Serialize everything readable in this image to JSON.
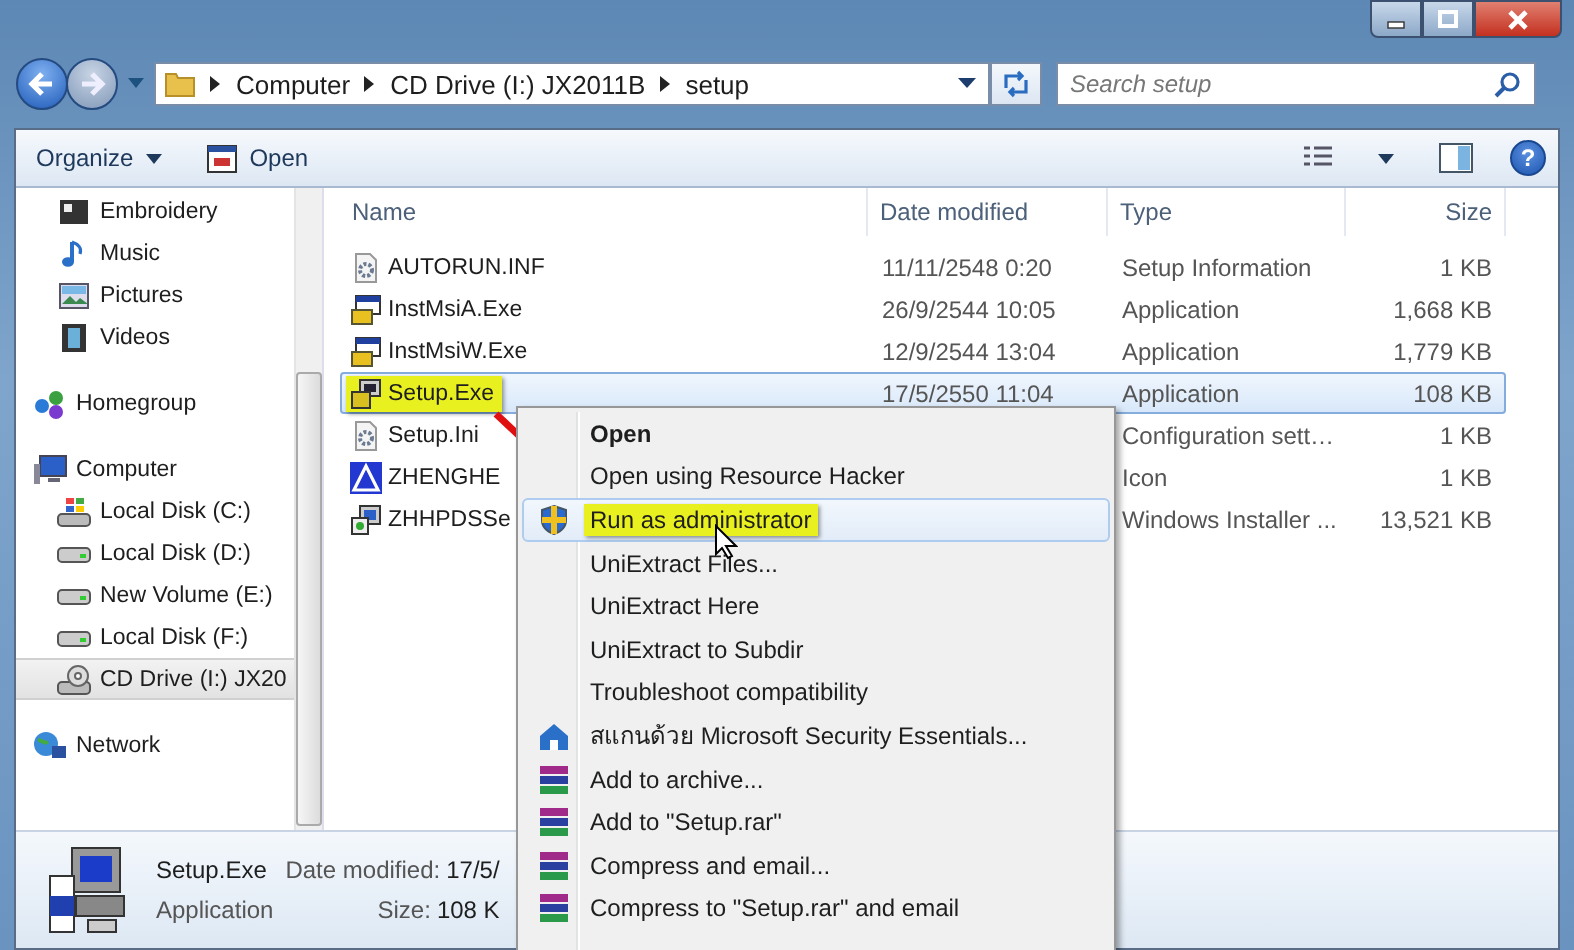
{
  "address_bar": {
    "crumbs": [
      "Computer",
      "CD Drive (I:) JX2011B",
      "setup"
    ]
  },
  "search": {
    "placeholder": "Search setup"
  },
  "toolbar": {
    "buttons": [
      {
        "label": "Organize",
        "kind": "menu"
      },
      {
        "label": "Open",
        "kind": "open"
      }
    ],
    "help": "?"
  },
  "sidebar": {
    "groups": [
      {
        "children": [
          {
            "label": "Embroidery",
            "selected": false
          },
          {
            "label": "Music",
            "selected": false
          },
          {
            "label": "Pictures",
            "selected": false
          },
          {
            "label": "Videos",
            "selected": false
          }
        ]
      },
      {
        "label": "Homegroup"
      },
      {
        "label": "Computer",
        "children": [
          {
            "label": "Local Disk (C:)",
            "selected": false
          },
          {
            "label": "Local Disk (D:)",
            "selected": false
          },
          {
            "label": "New Volume (E:)",
            "selected": false
          },
          {
            "label": "Local Disk (F:)",
            "selected": false
          },
          {
            "label": "CD Drive (I:) JX20",
            "selected": true
          }
        ]
      },
      {
        "label": "Network"
      }
    ]
  },
  "table": {
    "columns": [
      "Name",
      "Date modified",
      "Type",
      "Size"
    ],
    "rows": [
      {
        "name": "AUTORUN.INF",
        "date": "11/11/2548 0:20",
        "type": "Setup Information",
        "size": "1 KB",
        "selected": false,
        "highlighted": false
      },
      {
        "name": "InstMsiA.Exe",
        "date": "26/9/2544 10:05",
        "type": "Application",
        "size": "1,668 KB",
        "selected": false,
        "highlighted": false
      },
      {
        "name": "InstMsiW.Exe",
        "date": "12/9/2544 13:04",
        "type": "Application",
        "size": "1,779 KB",
        "selected": false,
        "highlighted": false
      },
      {
        "name": "Setup.Exe",
        "date": "17/5/2550 11:04",
        "type": "Application",
        "size": "108 KB",
        "selected": true,
        "highlighted": true
      },
      {
        "name": "Setup.Ini",
        "type": "Configuration sett…",
        "size": "1 KB",
        "selected": false,
        "highlighted": false
      },
      {
        "name": "ZHENGHE",
        "type": "Icon",
        "size": "1 KB",
        "selected": false,
        "highlighted": false
      },
      {
        "name": "ZHHPDSSe",
        "type": "Windows Installer ...",
        "size": "13,521 KB",
        "selected": false,
        "highlighted": false
      }
    ]
  },
  "context_menu": {
    "items": [
      {
        "label": "Open",
        "default": true,
        "selected": false,
        "highlighted": false
      },
      {
        "label": "Open using Resource Hacker",
        "default": false,
        "selected": false,
        "highlighted": false
      },
      {
        "label": "Run as administrator",
        "default": false,
        "selected": true,
        "highlighted": true
      },
      {
        "label": "UniExtract Files...",
        "default": false,
        "selected": false,
        "highlighted": false
      },
      {
        "label": "UniExtract Here",
        "default": false,
        "selected": false,
        "highlighted": false
      },
      {
        "label": "UniExtract to Subdir",
        "default": false,
        "selected": false,
        "highlighted": false
      },
      {
        "label": "Troubleshoot compatibility",
        "default": false,
        "selected": false,
        "highlighted": false
      },
      {
        "label": "สแกนด้วย Microsoft Security Essentials...",
        "default": false,
        "selected": false,
        "highlighted": false
      },
      {
        "label": "Add to archive...",
        "default": false,
        "selected": false,
        "highlighted": false
      },
      {
        "label": "Add to \"Setup.rar\"",
        "default": false,
        "selected": false,
        "highlighted": false
      },
      {
        "label": "Compress and email...",
        "default": false,
        "selected": false,
        "highlighted": false
      },
      {
        "label": "Compress to \"Setup.rar\" and email",
        "default": false,
        "selected": false,
        "highlighted": false
      }
    ]
  },
  "details_pane": {
    "name": "Setup.Exe",
    "type": "Application",
    "fields": [
      {
        "label": "Date modified:",
        "value": "17/5/"
      },
      {
        "label": "Size:",
        "value": "108 K"
      }
    ]
  }
}
